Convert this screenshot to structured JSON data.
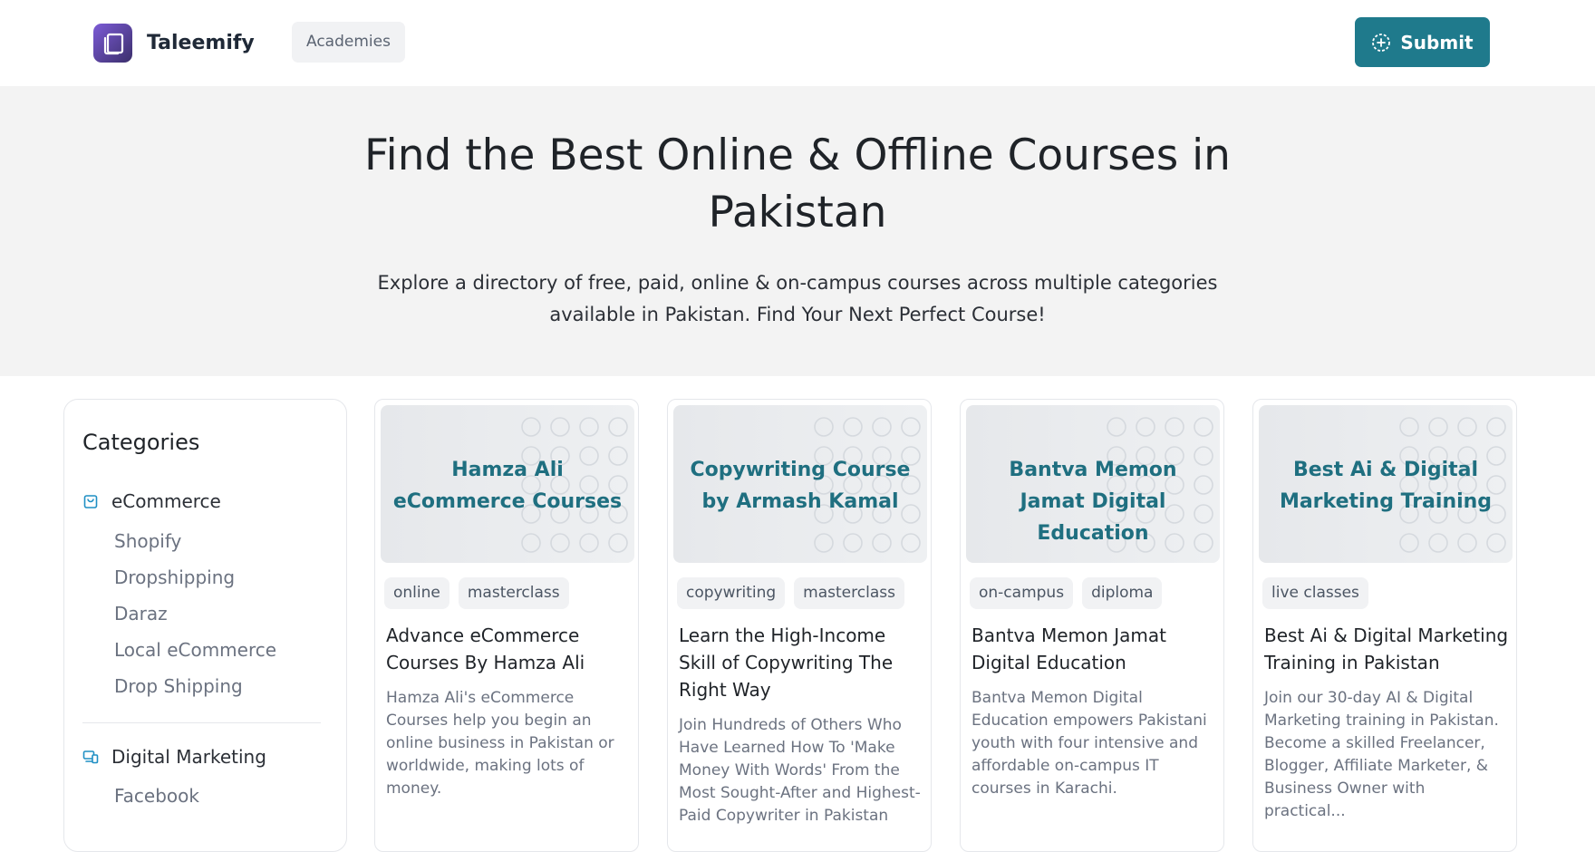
{
  "header": {
    "brand_name": "Taleemify",
    "logo_icon": "book-copy-icon",
    "nav_academies": "Academies",
    "submit_label": "Submit",
    "accent_color": "#1f7a8c"
  },
  "hero": {
    "title": "Find the Best Online & Offline Courses in Pakistan",
    "subtitle": "Explore a directory of free, paid, online & on-campus courses across multiple categories available in Pakistan. Find Your Next Perfect Course!"
  },
  "sidebar": {
    "title": "Categories",
    "categories": [
      {
        "label": "eCommerce",
        "icon": "shopping-bag-icon",
        "items": [
          "Shopify",
          "Dropshipping",
          "Daraz",
          "Local eCommerce",
          "Drop Shipping"
        ]
      },
      {
        "label": "Digital Marketing",
        "icon": "devices-icon",
        "items": [
          "Facebook"
        ]
      }
    ]
  },
  "courses": [
    {
      "thumb_title": "Hamza Ali eCommerce Courses",
      "tags": [
        "online",
        "masterclass"
      ],
      "title": "Advance eCommerce Courses By Hamza Ali",
      "description": "Hamza Ali's eCommerce Courses help you begin an online business in Pakistan or worldwide, making lots of money."
    },
    {
      "thumb_title": "Copywriting Course by Armash Kamal",
      "tags": [
        "copywriting",
        "masterclass"
      ],
      "title": "Learn the High-Income Skill of Copywriting The Right Way",
      "description": "Join Hundreds of Others Who Have Learned How To 'Make Money With Words' From the Most Sought-After and Highest-Paid Copywriter in Pakistan"
    },
    {
      "thumb_title": "Bantva Memon Jamat Digital Education",
      "tags": [
        "on-campus",
        "diploma"
      ],
      "title": "Bantva Memon Jamat Digital Education",
      "description": "Bantva Memon Digital Education empowers Pakistani youth with four intensive and affordable on-campus IT courses in Karachi."
    },
    {
      "thumb_title": "Best Ai & Digital Marketing Training",
      "tags": [
        "live classes"
      ],
      "title": "Best Ai & Digital Marketing Training in Pakistan",
      "description": "Join our 30-day AI & Digital Marketing training in Pakistan. Become a skilled Freelancer, Blogger, Affiliate Marketer, & Business Owner with practical..."
    }
  ]
}
